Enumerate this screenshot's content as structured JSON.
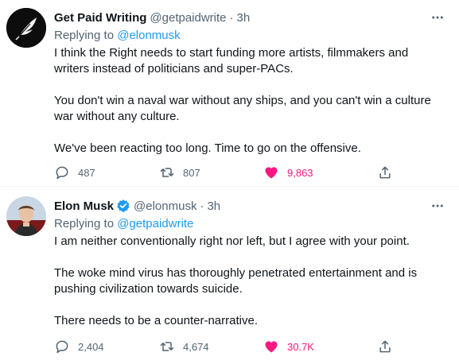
{
  "tweets": [
    {
      "author_name": "Get Paid Writing",
      "handle": "@getpaidwrite",
      "separator": "·",
      "time": "3h",
      "replying_prefix": "Replying to",
      "replying_to": "@elonmusk",
      "paragraphs": [
        "I think the Right needs to start funding more artists, filmmakers and writers instead of politicians and super-PACs.",
        "You don't win a naval war without any ships, and you can't win a culture war without any culture.",
        "We've been reacting too long. Time to go on the offensive."
      ],
      "replies": "487",
      "retweets": "807",
      "likes": "9,863",
      "liked": true,
      "avatar_icon": "feather-quill-icon"
    },
    {
      "author_name": "Elon Musk",
      "verified": true,
      "handle": "@elonmusk",
      "separator": "·",
      "time": "3h",
      "replying_prefix": "Replying to",
      "replying_to": "@getpaidwrite",
      "paragraphs": [
        "I am neither conventionally right nor left, but I agree with your point.",
        "The woke mind virus has thoroughly penetrated entertainment and is pushing civilization towards suicide.",
        "There needs to be a counter-narrative."
      ],
      "replies": "2,404",
      "retweets": "4,674",
      "likes": "30.7K",
      "liked": true,
      "avatar_icon": "user-photo-avatar"
    }
  ],
  "colors": {
    "text": "#0f1419",
    "secondary": "#536471",
    "link": "#1d9bf0",
    "like": "#f91880",
    "verified": "#1d9bf0"
  }
}
